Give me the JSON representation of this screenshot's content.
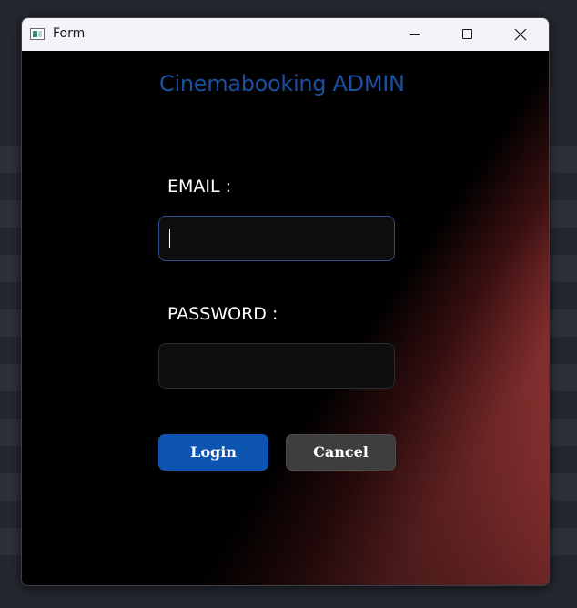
{
  "window": {
    "title": "Form",
    "app_icon": "form-app-icon",
    "controls": {
      "minimize_icon": "minimize-icon",
      "maximize_icon": "maximize-icon",
      "close_icon": "close-icon"
    }
  },
  "form": {
    "heading": "Cinemabooking ADMIN",
    "email_label": "EMAIL :",
    "email_value": "",
    "email_placeholder": "",
    "password_label": "PASSWORD :",
    "password_value": "",
    "password_placeholder": "",
    "login_label": "Login",
    "cancel_label": "Cancel"
  },
  "colors": {
    "heading": "#1b4f9f",
    "login_button": "#0d53b0",
    "cancel_button": "#3e3e3e",
    "background_accent": "#ee5252",
    "background": "#000000"
  }
}
